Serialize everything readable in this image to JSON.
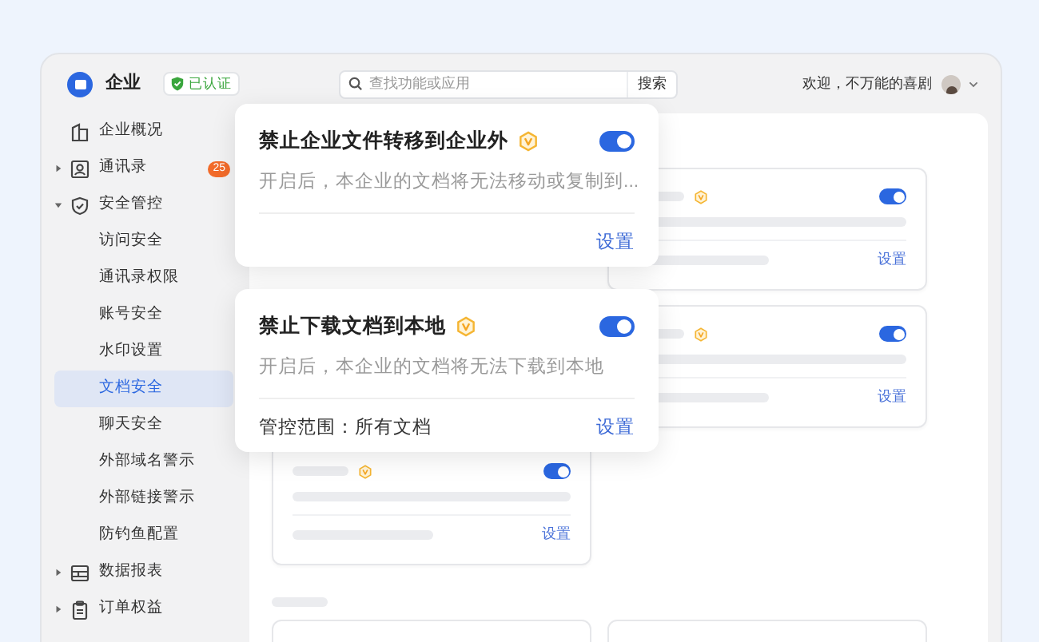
{
  "header": {
    "org_name": "企业",
    "verified_badge": "已认证",
    "search": {
      "placeholder": "查找功能或应用",
      "button": "搜索"
    },
    "welcome": "欢迎，不万能的喜剧"
  },
  "sidebar": {
    "items": [
      {
        "label": "企业概况",
        "kind": "overview",
        "selected": false
      },
      {
        "label": "通讯录",
        "kind": "contacts",
        "expanded": false,
        "selected": false,
        "badge": "25"
      },
      {
        "label": "安全管控",
        "kind": "security",
        "expanded": true,
        "selected": false,
        "children": [
          {
            "label": "访问安全",
            "selected": false
          },
          {
            "label": "通讯录权限",
            "selected": false
          },
          {
            "label": "账号安全",
            "selected": false
          },
          {
            "label": "水印设置",
            "selected": false
          },
          {
            "label": "文档安全",
            "selected": true
          },
          {
            "label": "聊天安全",
            "selected": false
          },
          {
            "label": "外部域名警示",
            "selected": false
          },
          {
            "label": "外部链接警示",
            "selected": false
          },
          {
            "label": "防钓鱼配置",
            "selected": false
          }
        ]
      },
      {
        "label": "数据报表",
        "kind": "reports",
        "expanded": false,
        "selected": false
      },
      {
        "label": "订单权益",
        "kind": "orders",
        "expanded": false,
        "selected": false
      }
    ]
  },
  "policy_cards": [
    {
      "title": "禁止企业文件转移到企业外",
      "on": true,
      "description": "开启后，本企业的文档将无法移动或复制到...",
      "link": "设置"
    },
    {
      "title": "禁止下载文档到本地",
      "on": true,
      "description": "开启后，本企业的文档将无法下载到本地",
      "scope": "管控范围：所有文档",
      "link": "设置"
    }
  ],
  "background_cards": [
    {
      "on": true,
      "link": "设置"
    },
    {
      "on": true,
      "link": "设置"
    },
    {
      "on": true,
      "link": "设置"
    }
  ]
}
